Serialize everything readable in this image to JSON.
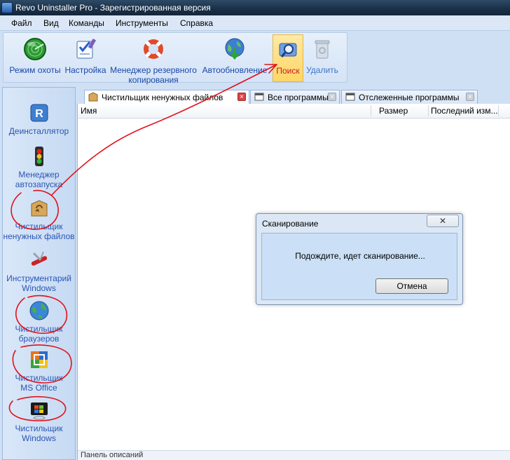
{
  "window": {
    "title": "Revo Uninstaller Pro - Зарегистрированная версия"
  },
  "menu": [
    "Файл",
    "Вид",
    "Команды",
    "Инструменты",
    "Справка"
  ],
  "toolbar": {
    "hunter": "Режим охоты",
    "settings": "Настройка",
    "backup_1": "Менеджер резервного",
    "backup_2": "копирования",
    "autoupdate": "Автообновление",
    "search": "Поиск",
    "delete": "Удалить"
  },
  "sidebar": {
    "uninstaller": "Деинсталлятор",
    "autorun_1": "Менеджер",
    "autorun_2": "автозапуска",
    "junk_1": "Чистильщик",
    "junk_2": "ненужных файлов",
    "wintools_1": "Инструментарий",
    "wintools_2": "Windows",
    "browsers_1": "Чистильщик",
    "browsers_2": "браузеров",
    "office_1": "Чистильщик",
    "office_2": "MS Office",
    "windows_1": "Чистильщик",
    "windows_2": "Windows"
  },
  "tabs": {
    "junk": "Чистильщик ненужных файлов",
    "all": "Все программы",
    "traced": "Отслеженные программы",
    "close": "×"
  },
  "table": {
    "col_name": "Имя",
    "col_size": "Размер",
    "col_modified": "Последний изм..."
  },
  "bottom_panel": "Панель описаний",
  "dialog": {
    "title": "Сканирование",
    "close": "✕",
    "message": "Подождите, идет сканирование...",
    "cancel": "Отмена"
  },
  "colors": {
    "annotation": "#e0131b",
    "link_text": "#2a55b3",
    "active_tool_text": "#c21b1b"
  }
}
